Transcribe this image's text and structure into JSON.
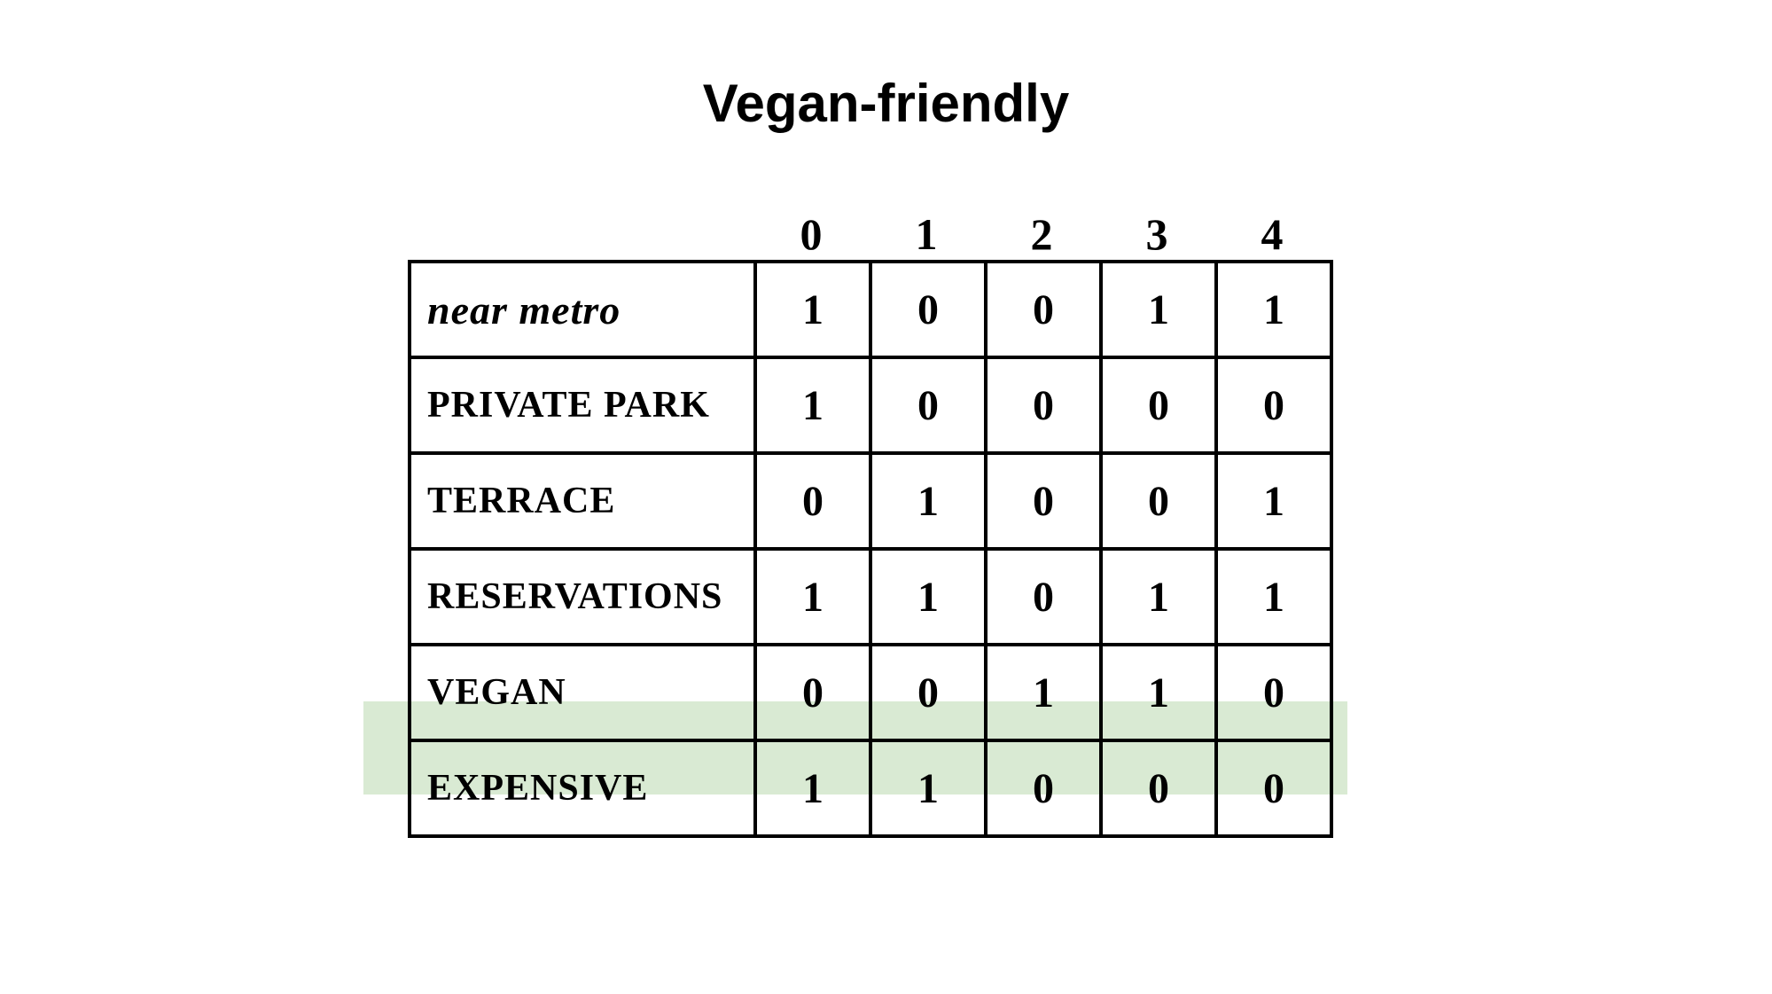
{
  "title": "Vegan-friendly",
  "chart_data": {
    "type": "table",
    "title": "Vegan-friendly",
    "columns": [
      "0",
      "1",
      "2",
      "3",
      "4"
    ],
    "rows": [
      {
        "label": "near metro",
        "values": [
          1,
          0,
          0,
          1,
          1
        ]
      },
      {
        "label": "PRIVATE PARK",
        "values": [
          1,
          0,
          0,
          0,
          0
        ]
      },
      {
        "label": "TERRACE",
        "values": [
          0,
          1,
          0,
          0,
          1
        ]
      },
      {
        "label": "RESERVATIONS",
        "values": [
          1,
          1,
          0,
          1,
          1
        ]
      },
      {
        "label": "VEGAN",
        "values": [
          0,
          0,
          1,
          1,
          0
        ],
        "highlighted": true
      },
      {
        "label": "EXPENSIVE",
        "values": [
          1,
          1,
          0,
          0,
          0
        ]
      }
    ],
    "highlight_color": "#d9ead3"
  }
}
